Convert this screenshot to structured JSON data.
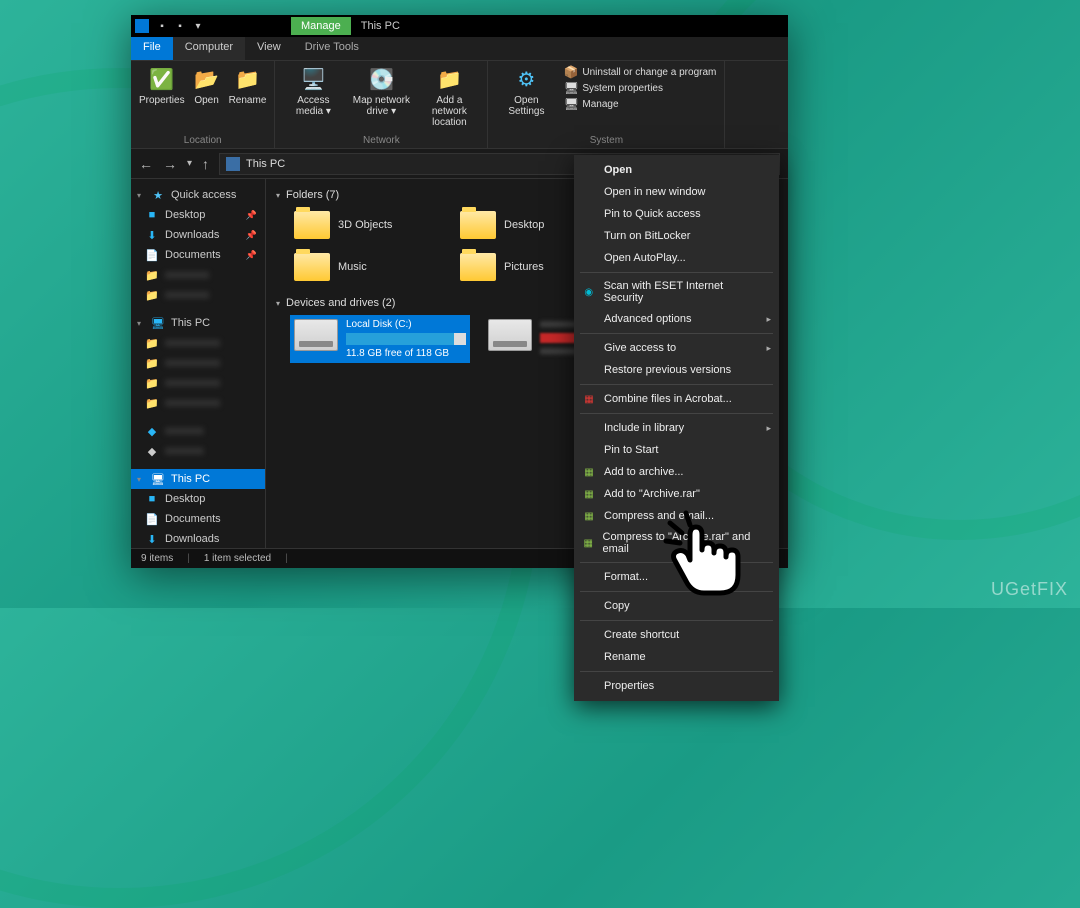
{
  "titlebar": {
    "manage_tab": "Manage",
    "thispc_tab": "This PC"
  },
  "menutabs": {
    "file": "File",
    "computer": "Computer",
    "view": "View",
    "drive_tools": "Drive Tools"
  },
  "ribbon": {
    "location": {
      "properties": "Properties",
      "open": "Open",
      "rename": "Rename",
      "label": "Location"
    },
    "network": {
      "access_media": "Access media ▾",
      "map_drive": "Map network drive ▾",
      "add_location": "Add a network location",
      "label": "Network"
    },
    "system": {
      "open_settings": "Open Settings",
      "uninstall": "Uninstall or change a program",
      "sys_props": "System properties",
      "manage": "Manage",
      "label": "System"
    }
  },
  "breadcrumb": "This PC",
  "sidebar": {
    "quick_access": "Quick access",
    "desktop": "Desktop",
    "downloads": "Downloads",
    "documents": "Documents",
    "this_pc": "This PC",
    "this_pc2": "This PC",
    "desktop2": "Desktop",
    "documents2": "Documents",
    "downloads2": "Downloads"
  },
  "content": {
    "folders_header": "Folders (7)",
    "folders": {
      "f1": "3D Objects",
      "f2": "Desktop",
      "f3": "Music",
      "f4": "Pictures"
    },
    "drives_header": "Devices and drives (2)",
    "drive1_label": "Local Disk (C:)",
    "drive1_free": "11.8 GB free of 118 GB"
  },
  "statusbar": {
    "items": "9 items",
    "selected": "1 item selected"
  },
  "context": {
    "open": "Open",
    "open_new": "Open in new window",
    "pin_qa": "Pin to Quick access",
    "bitlocker": "Turn on BitLocker",
    "autoplay": "Open AutoPlay...",
    "eset": "Scan with ESET Internet Security",
    "adv_opts": "Advanced options",
    "give_access": "Give access to",
    "restore": "Restore previous versions",
    "acrobat": "Combine files in Acrobat...",
    "include_lib": "Include in library",
    "pin_start": "Pin to Start",
    "add_archive": "Add to archive...",
    "add_rar": "Add to \"Archive.rar\"",
    "compress_email": "Compress and email...",
    "compress_rar_email": "Compress to \"Archive.rar\" and email",
    "format": "Format...",
    "copy": "Copy",
    "shortcut": "Create shortcut",
    "rename": "Rename",
    "properties": "Properties"
  },
  "watermark": "UGetFIX"
}
